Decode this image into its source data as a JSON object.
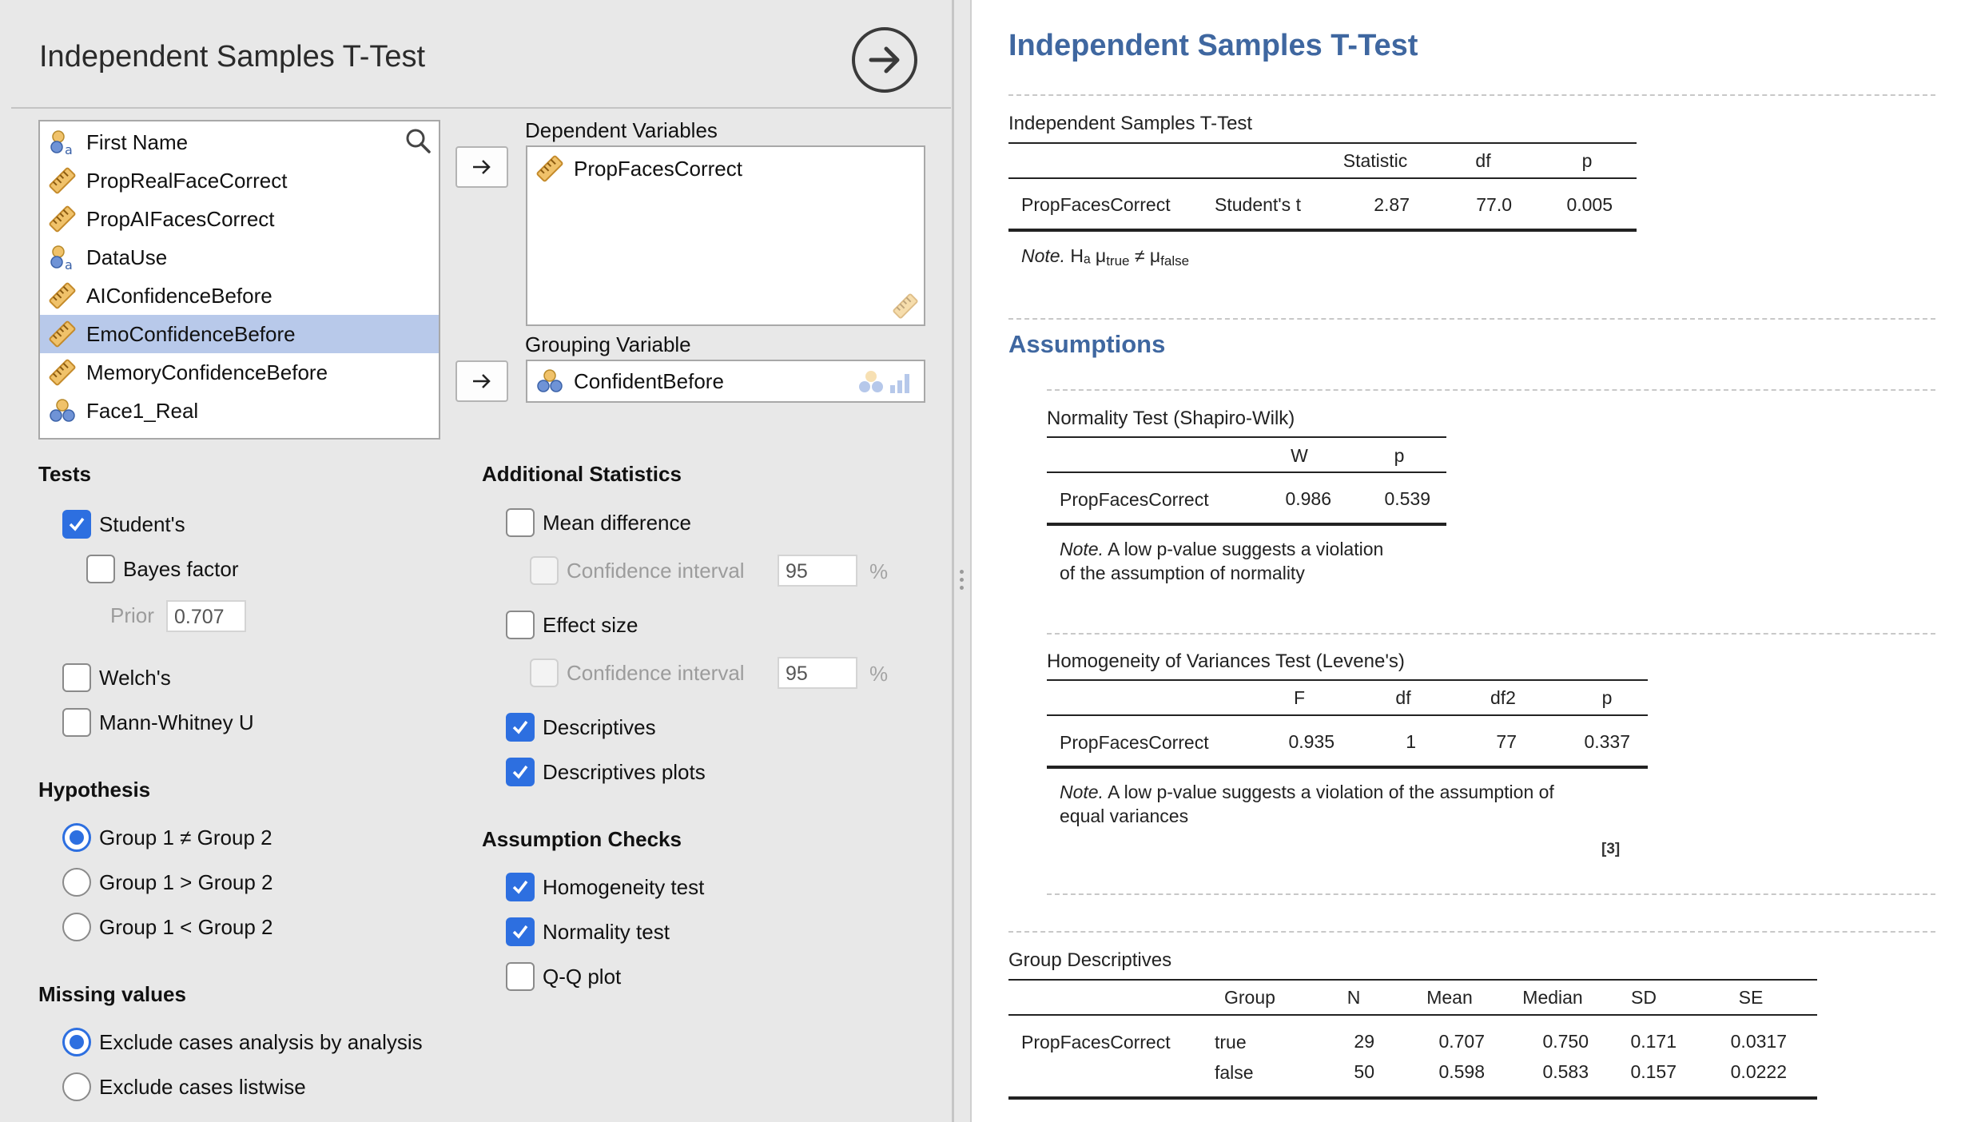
{
  "left": {
    "title": "Independent Samples T-Test",
    "variables": [
      {
        "label": "First Name",
        "type": "nominal-text",
        "selected": false
      },
      {
        "label": "PropRealFaceCorrect",
        "type": "scale",
        "selected": false
      },
      {
        "label": "PropAIFacesCorrect",
        "type": "scale",
        "selected": false
      },
      {
        "label": "DataUse",
        "type": "nominal-text",
        "selected": false
      },
      {
        "label": "AIConfidenceBefore",
        "type": "scale",
        "selected": false
      },
      {
        "label": "EmoConfidenceBefore",
        "type": "scale",
        "selected": true
      },
      {
        "label": "MemoryConfidenceBefore",
        "type": "scale",
        "selected": false
      },
      {
        "label": "Face1_Real",
        "type": "nominal",
        "selected": false
      }
    ],
    "dependent": {
      "caption": "Dependent Variables",
      "items": [
        "PropFacesCorrect"
      ]
    },
    "grouping": {
      "caption": "Grouping Variable",
      "value": "ConfidentBefore"
    },
    "tests": {
      "heading": "Tests",
      "students": {
        "label": "Student's",
        "checked": true
      },
      "bayes": {
        "label": "Bayes factor",
        "checked": false
      },
      "prior_label": "Prior",
      "prior_value": "0.707",
      "welch": {
        "label": "Welch's",
        "checked": false
      },
      "mann": {
        "label": "Mann-Whitney U",
        "checked": false
      }
    },
    "hypothesis": {
      "heading": "Hypothesis",
      "options": [
        "Group 1 ≠ Group 2",
        "Group 1 > Group 2",
        "Group 1 < Group 2"
      ],
      "selected_index": 0
    },
    "missing": {
      "heading": "Missing values",
      "options": [
        "Exclude cases analysis by analysis",
        "Exclude cases listwise"
      ],
      "selected_index": 0
    },
    "additional": {
      "heading": "Additional Statistics",
      "mean_diff": {
        "label": "Mean difference",
        "checked": false
      },
      "ci_label": "Confidence interval",
      "ci_value": "95",
      "pct": "%",
      "effect_size": {
        "label": "Effect size",
        "checked": false
      },
      "descriptives": {
        "label": "Descriptives",
        "checked": true
      },
      "desc_plots": {
        "label": "Descriptives plots",
        "checked": true
      }
    },
    "assumption_checks": {
      "heading": "Assumption Checks",
      "homogeneity": {
        "label": "Homogeneity test",
        "checked": true
      },
      "normality": {
        "label": "Normality test",
        "checked": true
      },
      "qq": {
        "label": "Q-Q plot",
        "checked": false
      }
    }
  },
  "right": {
    "title": "Independent Samples T-Test",
    "ttest": {
      "title": "Independent Samples T-Test",
      "headers": [
        "Statistic",
        "df",
        "p"
      ],
      "row": {
        "variable": "PropFacesCorrect",
        "test": "Student's t",
        "statistic": "2.87",
        "df": "77.0",
        "p": "0.005"
      },
      "note_label": "Note.",
      "note_h": "Hₐ μ",
      "note_true": "true",
      "note_neq": "≠ μ",
      "note_false": "false"
    },
    "assumptions_heading": "Assumptions",
    "normality": {
      "title": "Normality Test (Shapiro-Wilk)",
      "headers": [
        "W",
        "p"
      ],
      "row": {
        "variable": "PropFacesCorrect",
        "w": "0.986",
        "p": "0.539"
      },
      "note_label": "Note.",
      "note_line1": "A low p-value suggests a violation",
      "note_line2": "of the assumption of normality"
    },
    "levene": {
      "title": "Homogeneity of Variances Test (Levene's)",
      "headers": [
        "F",
        "df",
        "df2",
        "p"
      ],
      "row": {
        "variable": "PropFacesCorrect",
        "f": "0.935",
        "df": "1",
        "df2": "77",
        "p": "0.337"
      },
      "note_label": "Note.",
      "note_line1": "A low p-value suggests a violation of the assumption of",
      "note_line2": "equal variances",
      "ref": "[3]"
    },
    "descriptives": {
      "title": "Group Descriptives",
      "headers": [
        "Group",
        "N",
        "Mean",
        "Median",
        "SD",
        "SE"
      ],
      "variable": "PropFacesCorrect",
      "rows": [
        {
          "group": "true",
          "n": "29",
          "mean": "0.707",
          "median": "0.750",
          "sd": "0.171",
          "se": "0.0317"
        },
        {
          "group": "false",
          "n": "50",
          "mean": "0.598",
          "median": "0.583",
          "sd": "0.157",
          "se": "0.0222"
        }
      ]
    }
  },
  "colors": {
    "accent_blue": "#2d6fe0",
    "heading_blue": "#3f67a0",
    "selection": "#b8c9ea"
  }
}
